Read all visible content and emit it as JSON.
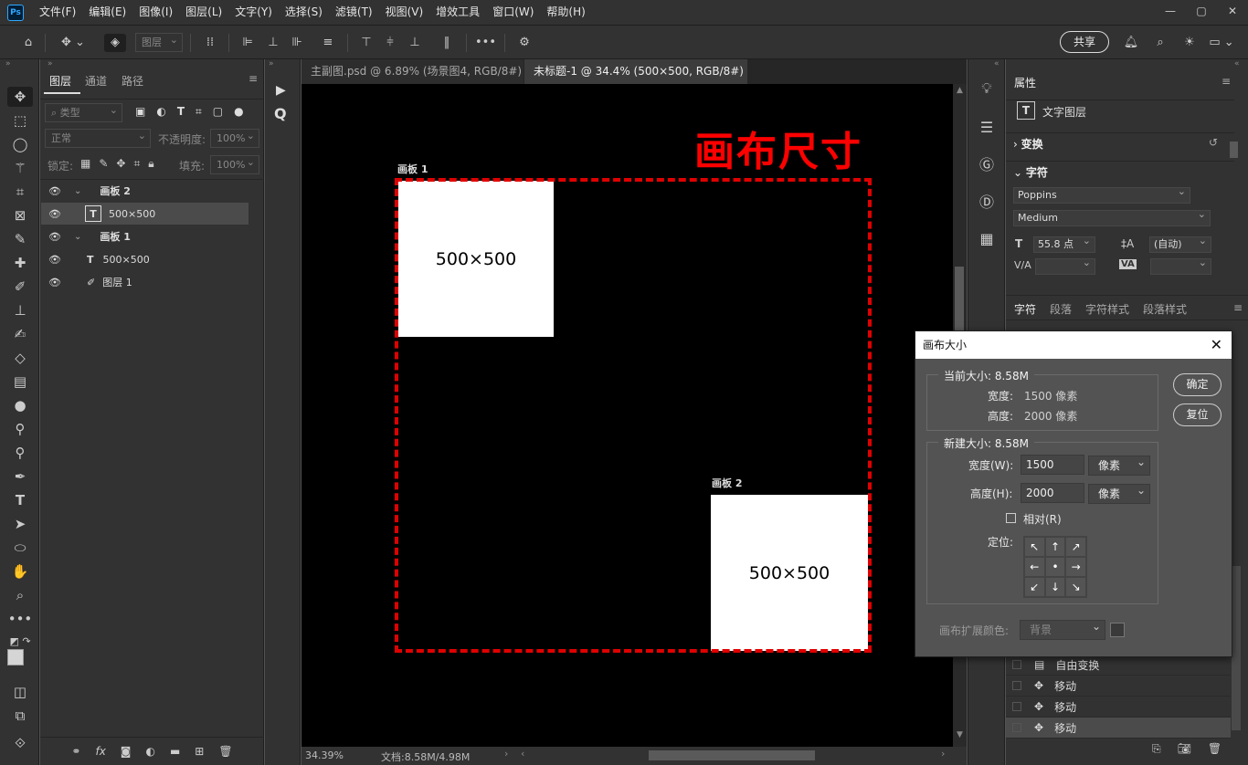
{
  "menubar": {
    "logo": "Ps",
    "items": [
      "文件(F)",
      "编辑(E)",
      "图像(I)",
      "图层(L)",
      "文字(Y)",
      "选择(S)",
      "滤镜(T)",
      "视图(V)",
      "增效工具",
      "窗口(W)",
      "帮助(H)"
    ],
    "win": [
      "—",
      "▢",
      "✕"
    ]
  },
  "options": {
    "layer_dropdown": "图层",
    "share": "共享"
  },
  "layers_panel": {
    "tabs": [
      "图层",
      "通道",
      "路径"
    ],
    "filter": "类型",
    "blend": "正常",
    "opacity_label": "不透明度:",
    "opacity": "100%",
    "lock_label": "锁定:",
    "fill_label": "填充:",
    "fill": "100%",
    "rows": [
      {
        "name": "画板 2",
        "kind": "group"
      },
      {
        "name": "500×500",
        "kind": "text"
      },
      {
        "name": "画板 1",
        "kind": "group"
      },
      {
        "name": "500×500",
        "kind": "text"
      },
      {
        "name": "图层 1",
        "kind": "brush"
      }
    ]
  },
  "doc_tabs": [
    {
      "label": "主副图.psd @ 6.89% (场景图4, RGB/8#)",
      "close": "×"
    },
    {
      "label": "未标题-1 @ 34.4% (500×500, RGB/8#) *",
      "close": "×"
    }
  ],
  "canvas": {
    "title": "画布尺寸",
    "artboard1": "画板 1",
    "artboard2": "画板 2",
    "box1": "500×500",
    "box2": "500×500"
  },
  "status": {
    "zoom": "34.39%",
    "doc": "文档:8.58M/4.98M"
  },
  "properties": {
    "title": "属性",
    "layer_type": "文字图层",
    "transform": "变换",
    "char_section": "字符",
    "font": "Poppins",
    "style": "Medium",
    "size": "55.8 点",
    "leading": "(自动)",
    "tracking_label": "V/A",
    "kerning_label": "VA"
  },
  "lower_tabs": [
    "字符",
    "段落",
    "字符样式",
    "段落样式"
  ],
  "history": [
    {
      "label": "自由变换"
    },
    {
      "label": "移动"
    },
    {
      "label": "移动"
    },
    {
      "label": "移动"
    }
  ],
  "dialog": {
    "title": "画布大小",
    "current_legend": "当前大小: 8.58M",
    "width_label": "宽度:",
    "width_val": "1500 像素",
    "height_label": "高度:",
    "height_val": "2000 像素",
    "new_legend": "新建大小: 8.58M",
    "new_width_label": "宽度(W):",
    "new_width": "1500",
    "new_height_label": "高度(H):",
    "new_height": "2000",
    "unit": "像素",
    "relative": "相对(R)",
    "anchor_label": "定位:",
    "ok": "确定",
    "reset": "复位",
    "ext_label": "画布扩展颜色:",
    "ext_value": "背景",
    "anchor": [
      "↖",
      "↑",
      "↗",
      "←",
      "•",
      "→",
      "↙",
      "↓",
      "↘"
    ]
  }
}
